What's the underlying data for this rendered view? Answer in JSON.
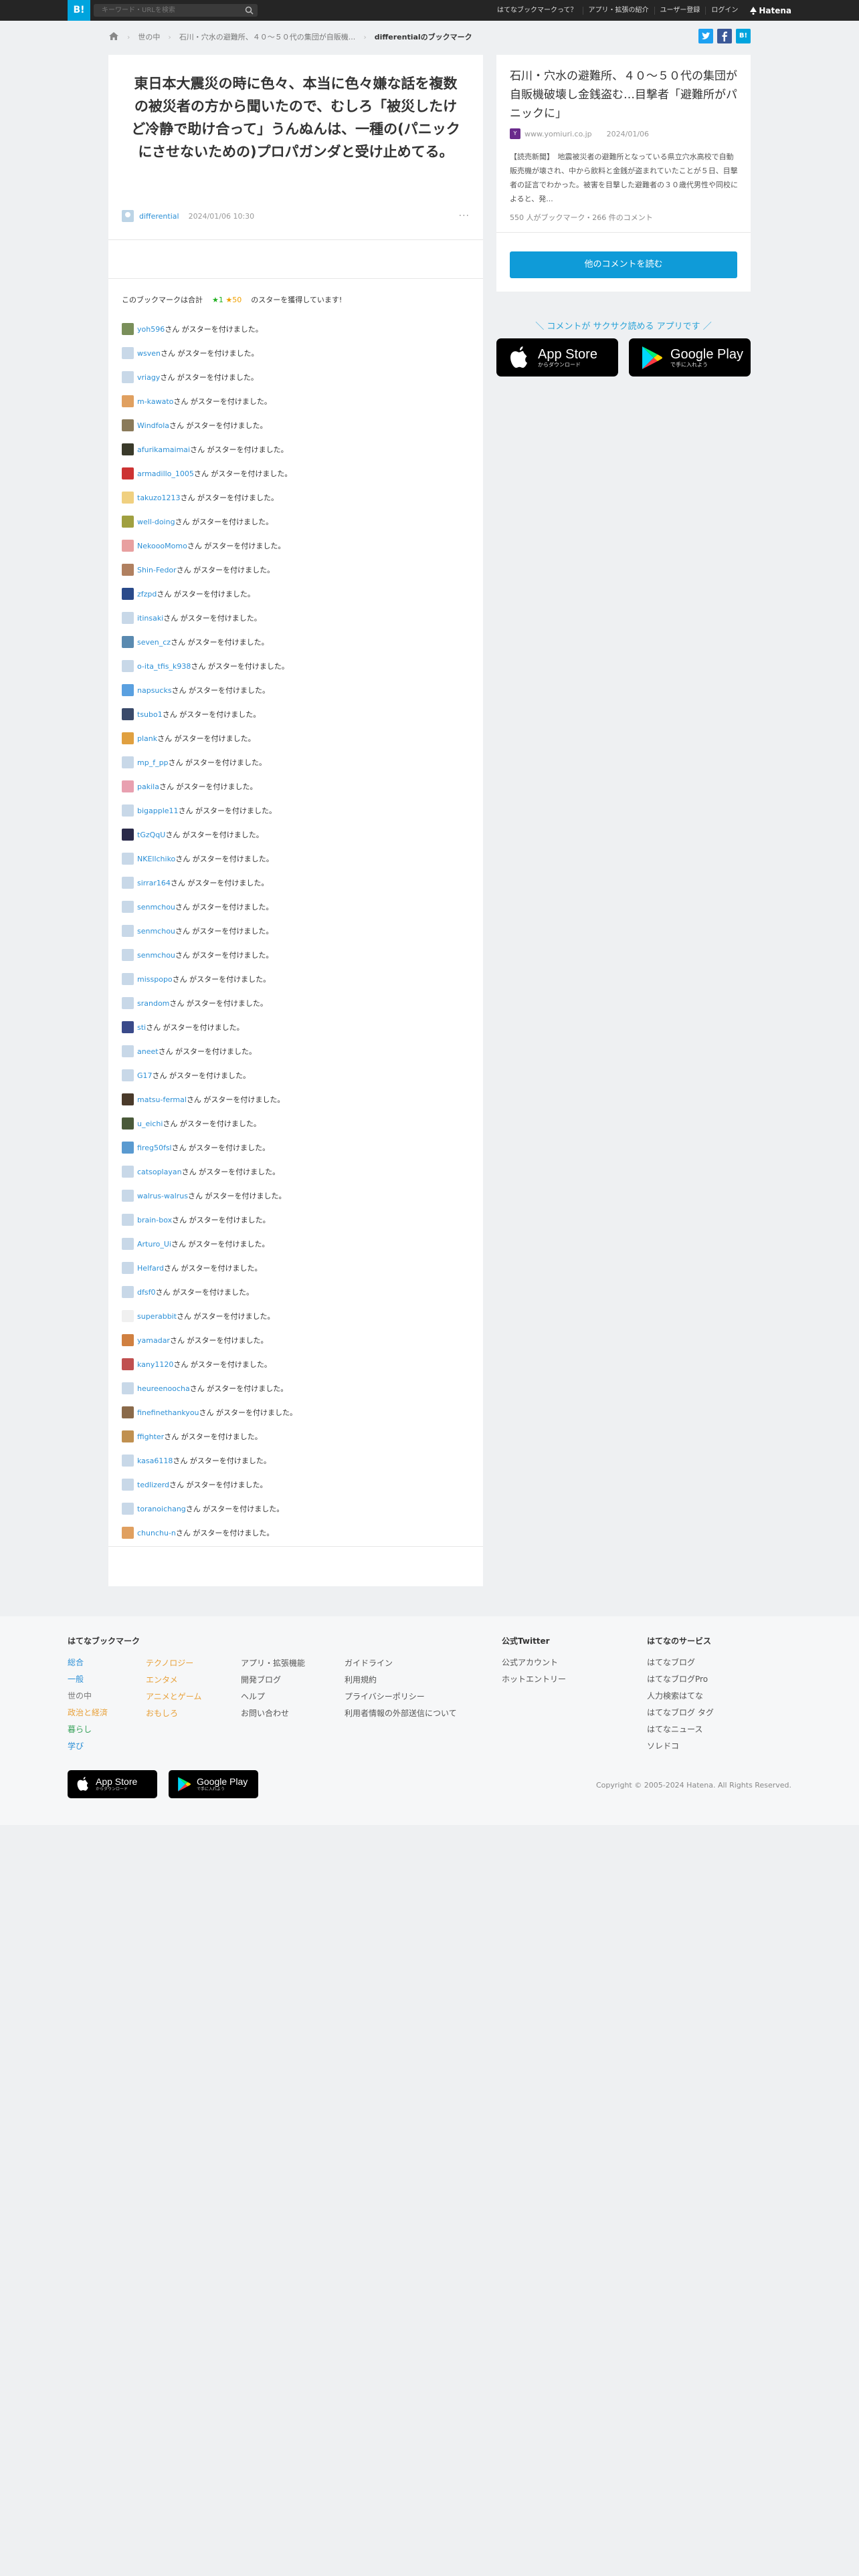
{
  "header": {
    "logo": "B!",
    "search_placeholder": "キーワード・URLを検索",
    "nav": [
      "はてなブックマークって？",
      "アプリ・拡張の紹介",
      "ユーザー登録",
      "ログイン"
    ],
    "brand": "Hatena",
    "brand_color": "#00a4de"
  },
  "breadcrumb": {
    "home_icon": "home-icon",
    "items": [
      "世の中",
      "石川・穴水の避難所、４０～５０代の集団が自販機...",
      "differentialのブックマーク"
    ]
  },
  "share": {
    "twitter_color": "#1da1f2",
    "facebook_color": "#3b5998",
    "hatena_color": "#00a4de"
  },
  "bookmark": {
    "comment": "東日本大震災の時に色々、本当に色々嫌な話を複数の被災者の方から聞いたので、むしろ「被災したけど冷静で助け合って」うんぬんは、一種の(パニックにさせないための)プロパガンダと受け止めてる。",
    "user": "differential",
    "date": "2024/01/06 10:30",
    "more": "···"
  },
  "stars": {
    "prefix": "このブックマークは合計",
    "green": "★1",
    "yellow": "★50",
    "suffix": "のスターを獲得しています!",
    "suffix_text": "さん がスターを付けました。",
    "users": [
      {
        "name": "yoh596",
        "color": "#7a8f5a"
      },
      {
        "name": "wsven",
        "color": "#c8d8e8"
      },
      {
        "name": "vriagy",
        "color": "#c8d8e8"
      },
      {
        "name": "m-kawato",
        "color": "#e0a060"
      },
      {
        "name": "Windfola",
        "color": "#8a7a5a"
      },
      {
        "name": "afurikamaimai",
        "color": "#3a3a2a"
      },
      {
        "name": "armadillo_1005",
        "color": "#cc3333"
      },
      {
        "name": "takuzo1213",
        "color": "#f0d080"
      },
      {
        "name": "well-doing",
        "color": "#a0a040"
      },
      {
        "name": "NekoooMomo",
        "color": "#e8a0a0"
      },
      {
        "name": "Shin-Fedor",
        "color": "#b08060"
      },
      {
        "name": "zfzpd",
        "color": "#2a4a8a"
      },
      {
        "name": "itinsaki",
        "color": "#c8d8e8"
      },
      {
        "name": "seven_cz",
        "color": "#5a8ab0"
      },
      {
        "name": "o-ita_tfis_k938",
        "color": "#c8d8e8"
      },
      {
        "name": "napsucks",
        "color": "#5aa0e0"
      },
      {
        "name": "tsubo1",
        "color": "#3a4a6a"
      },
      {
        "name": "plank",
        "color": "#e0a040"
      },
      {
        "name": "mp_f_pp",
        "color": "#c8d8e8"
      },
      {
        "name": "pakila",
        "color": "#e8a0b0"
      },
      {
        "name": "bigapple11",
        "color": "#c8d8e8"
      },
      {
        "name": "tGzQqU",
        "color": "#2a2a4a"
      },
      {
        "name": "NKEllchiko",
        "color": "#c8d8e8"
      },
      {
        "name": "sirrar164",
        "color": "#c8d8e8"
      },
      {
        "name": "senmchou",
        "color": "#c8d8e8"
      },
      {
        "name": "senmchou",
        "color": "#c8d8e8"
      },
      {
        "name": "senmchou",
        "color": "#c8d8e8"
      },
      {
        "name": "misspopo",
        "color": "#c8d8e8"
      },
      {
        "name": "srandom",
        "color": "#c8d8e8"
      },
      {
        "name": "sti",
        "color": "#3a4a8a"
      },
      {
        "name": "aneet",
        "color": "#c8d8e8"
      },
      {
        "name": "G17",
        "color": "#c8d8e8"
      },
      {
        "name": "matsu-fermal",
        "color": "#4a3a2a"
      },
      {
        "name": "u_eichi",
        "color": "#4a5a3a"
      },
      {
        "name": "fireg50fsl",
        "color": "#5a9ad0"
      },
      {
        "name": "catsoplayan",
        "color": "#c8d8e8"
      },
      {
        "name": "walrus-walrus",
        "color": "#c8d8e8"
      },
      {
        "name": "brain-box",
        "color": "#c8d8e8"
      },
      {
        "name": "Arturo_Ui",
        "color": "#c8d8e8"
      },
      {
        "name": "Helfard",
        "color": "#c8d8e8"
      },
      {
        "name": "dfsf0",
        "color": "#c8d8e8"
      },
      {
        "name": "superabbit",
        "color": "#f0f0f0"
      },
      {
        "name": "yamadar",
        "color": "#d08040"
      },
      {
        "name": "kany1120",
        "color": "#c05050"
      },
      {
        "name": "heureenoocha",
        "color": "#c8d8e8"
      },
      {
        "name": "finefinethankyou",
        "color": "#8a6a4a"
      },
      {
        "name": "ffighter",
        "color": "#c09050"
      },
      {
        "name": "kasa6118",
        "color": "#c8d8e8"
      },
      {
        "name": "tedlizerd",
        "color": "#c8d8e8"
      },
      {
        "name": "toranoichang",
        "color": "#c8d8e8"
      },
      {
        "name": "chunchu-n",
        "color": "#e0a060"
      }
    ]
  },
  "entry": {
    "title": "石川・穴水の避難所、４０～５０代の集団が自販機破壊し金銭盗む…目撃者「避難所がパニックに」",
    "source": "www.yomiuri.co.jp",
    "date": "2024/01/06",
    "description": "【読売新聞】　地震被災者の避難所となっている県立穴水高校で自動販売機が壊され、中から飲料と金銭が盗まれていたことが５日、目撃者の証言でわかった。被害を目撃した避難者の３０歳代男性や同校によると、発...",
    "counts": "550 人がブックマーク・266 件のコメント",
    "read_button": "他のコメントを読む",
    "fav_text": "Y"
  },
  "promo": {
    "tagline": "＼ コメントが サクサク読める アプリです ／",
    "appstore_small": "からダウンロード",
    "appstore_big": "App Store",
    "googleplay_small": "で手に入れよう",
    "googleplay_big": "Google Play"
  },
  "footer": {
    "bookmark_heading": "はてなブックマーク",
    "col1": [
      {
        "label": "総合",
        "color": "c-blue"
      },
      {
        "label": "一般",
        "color": "c-blue"
      },
      {
        "label": "世の中",
        "color": "c-gray"
      },
      {
        "label": "政治と経済",
        "color": "c-orange"
      },
      {
        "label": "暮らし",
        "color": "c-green"
      },
      {
        "label": "学び",
        "color": "c-blue"
      }
    ],
    "col2": [
      {
        "label": "テクノロジー",
        "color": "c-orange"
      },
      {
        "label": "エンタメ",
        "color": "c-orange"
      },
      {
        "label": "アニメとゲーム",
        "color": "c-orange"
      },
      {
        "label": "おもしろ",
        "color": "c-orange"
      }
    ],
    "col3": [
      "アプリ・拡張機能",
      "開発ブログ",
      "ヘルプ",
      "お問い合わせ"
    ],
    "col4": [
      "ガイドライン",
      "利用規約",
      "プライバシーポリシー",
      "利用者情報の外部送信について"
    ],
    "twitter_heading": "公式Twitter",
    "twitter_items": [
      "公式アカウント",
      "ホットエントリー"
    ],
    "services_heading": "はてなのサービス",
    "services_items": [
      "はてなブログ",
      "はてなブログPro",
      "人力検索はてな",
      "はてなブログ タグ",
      "はてなニュース",
      "ソレドコ"
    ],
    "appstore_big": "App Store",
    "appstore_small": "からダウンロード",
    "googleplay_big": "Google Play",
    "googleplay_small": "で手に入れよう",
    "copyright": "Copyright © 2005-2024 Hatena. All Rights Reserved."
  }
}
